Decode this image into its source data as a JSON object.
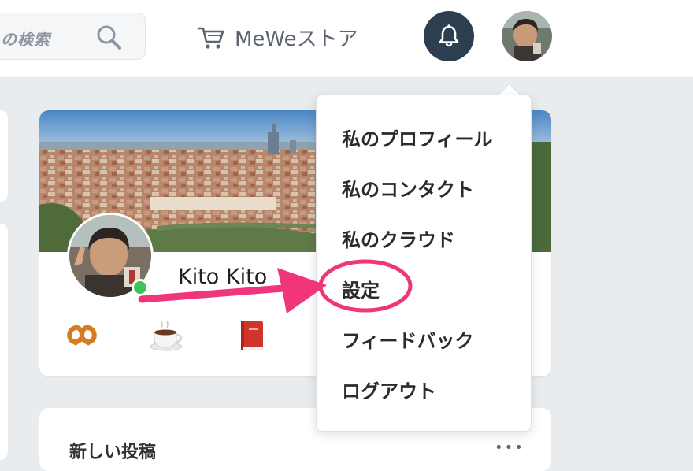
{
  "header": {
    "search": {
      "text": "の検索",
      "icon": "search-icon"
    },
    "store": {
      "label": "MeWeストア",
      "icon": "cart-icon"
    },
    "notifications": {
      "icon": "bell-icon",
      "background": "#2c3e50"
    }
  },
  "profile": {
    "name": "Kito Kito",
    "status_color": "#3cc45a",
    "badges": [
      "pretzel-icon",
      "coffee-icon",
      "book-icon"
    ]
  },
  "posts": {
    "title": "新しい投稿",
    "more": "•••"
  },
  "menu": {
    "items": [
      {
        "label": "私のプロフィール"
      },
      {
        "label": "私のコンタクト"
      },
      {
        "label": "私のクラウド"
      },
      {
        "label": "設定",
        "highlighted": true
      },
      {
        "label": "フィードバック"
      },
      {
        "label": "ログアウト"
      }
    ]
  },
  "annotation": {
    "color": "#f0357a",
    "target": "設定"
  }
}
